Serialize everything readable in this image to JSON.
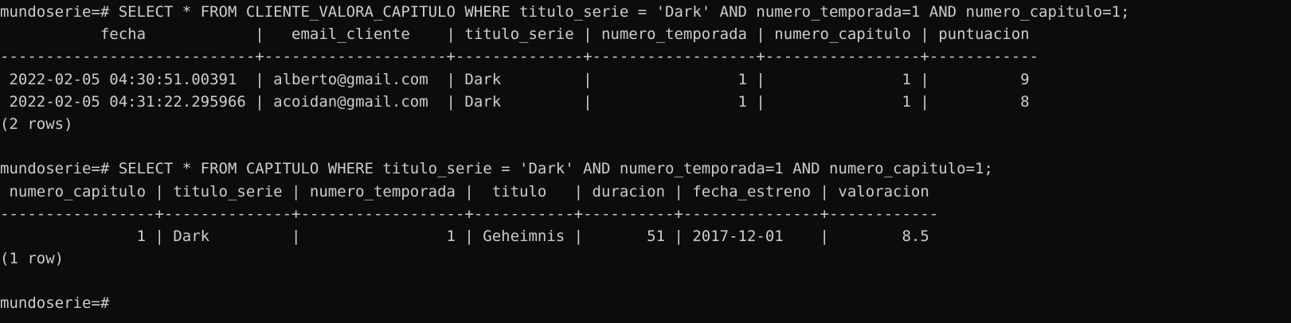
{
  "terminal": {
    "lines": [
      "mundoserie=# SELECT * FROM CLIENTE_VALORA_CAPITULO WHERE titulo_serie = 'Dark' AND numero_temporada=1 AND numero_capitulo=1;",
      "           fecha            |   email_cliente    | titulo_serie | numero_temporada | numero_capitulo | puntuacion",
      "----------------------------+--------------------+--------------+------------------+-----------------+------------",
      " 2022-02-05 04:30:51.00391  | alberto@gmail.com  | Dark         |                1 |               1 |          9",
      " 2022-02-05 04:31:22.295966 | acoidan@gmail.com  | Dark         |                1 |               1 |          8",
      "(2 rows)",
      "",
      "mundoserie=# SELECT * FROM CAPITULO WHERE titulo_serie = 'Dark' AND numero_temporada=1 AND numero_capitulo=1;",
      " numero_capitulo | titulo_serie | numero_temporada |  titulo   | duracion | fecha_estreno | valoracion",
      "-----------------+--------------+------------------+-----------+----------+---------------+------------",
      "               1 | Dark         |                1 | Geheimnis |       51 | 2017-12-01    |        8.5",
      "(1 row)",
      "",
      "mundoserie=#"
    ],
    "colors": {
      "background": "#0c0c0c",
      "foreground": "#cccccc"
    }
  }
}
